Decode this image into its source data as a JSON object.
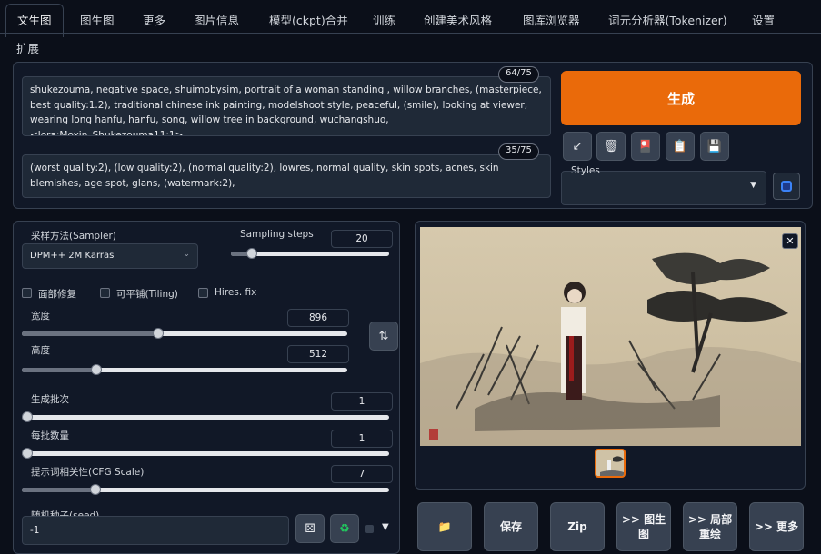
{
  "tabs": [
    "文生图",
    "图生图",
    "更多",
    "图片信息",
    "模型(ckpt)合并",
    "训练",
    "创建美术风格",
    "图库浏览器",
    "词元分析器(Tokenizer)",
    "设置",
    "扩展"
  ],
  "prompt": {
    "positive": "shukezouma, negative space, shuimobysim, portrait of a woman standing , willow branches, (masterpiece, best quality:1.2), traditional chinese ink painting, modelshoot style, peaceful, (smile), looking at viewer, wearing long hanfu, hanfu, song, willow tree in background, wuchangshuo,  <lora:Moxin_Shukezouma11:1>",
    "positive_count": "64/75",
    "negative": "(worst quality:2), (low quality:2), (normal quality:2), lowres, normal quality, skin spots, acnes, skin blemishes, age spot, glans, (watermark:2),",
    "negative_count": "35/75"
  },
  "generate_label": "生成",
  "tool_icons": [
    "↙",
    "🗑",
    "🎴",
    "📋",
    "💾"
  ],
  "styles_label": "Styles",
  "sampler": {
    "label": "采样方法(Sampler)",
    "value": "DPM++ 2M Karras"
  },
  "steps": {
    "label": "Sampling steps",
    "value": "20",
    "level": 0.13
  },
  "checkboxes": [
    "面部修复",
    "可平铺(Tiling)",
    "Hires. fix"
  ],
  "width": {
    "label": "宽度",
    "value": "896",
    "level": 0.42
  },
  "height": {
    "label": "高度",
    "value": "512",
    "level": 0.23
  },
  "batch_count": {
    "label": "生成批次",
    "value": "1",
    "level": 0.0
  },
  "batch_size": {
    "label": "每批数量",
    "value": "1",
    "level": 0.0
  },
  "cfg": {
    "label": "提示词相关性(CFG Scale)",
    "value": "7",
    "level": 0.2
  },
  "seed": {
    "label": "随机种子(seed)",
    "value": "-1"
  },
  "output_buttons": [
    "📁",
    "保存",
    "Zip",
    ">> 图生图",
    ">> 局部重绘",
    ">> 更多"
  ],
  "colors": {
    "accent": "#ea6a0a",
    "background": "#0b0f19"
  }
}
